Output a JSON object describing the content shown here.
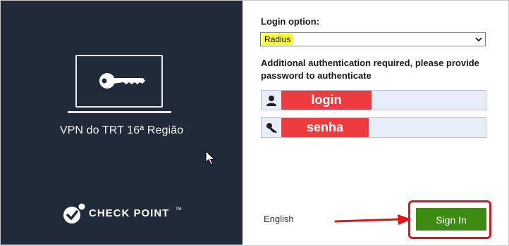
{
  "left_panel": {
    "site_name": "VPN do TRT 16ª Região",
    "logo_text": "CHECK POINT",
    "logo_tm": "TM",
    "background": "#202a38"
  },
  "login_form": {
    "login_option_label": "Login option:",
    "login_option_value": "Radius",
    "auth_message_line1": "Additional authentication required, please provide",
    "auth_message_line2": "password to authenticate",
    "username_field": {
      "icon": "user-icon",
      "redaction_label": "login"
    },
    "password_field": {
      "icon": "key-icon",
      "redaction_label": "senha"
    },
    "language_link": "English",
    "sign_in_label": "Sign In"
  },
  "colors": {
    "sign_in_button": "#3d8b13",
    "highlight_box": "#e3131a",
    "redaction": "#ee3b3f",
    "select_highlight": "#ffff2e"
  }
}
